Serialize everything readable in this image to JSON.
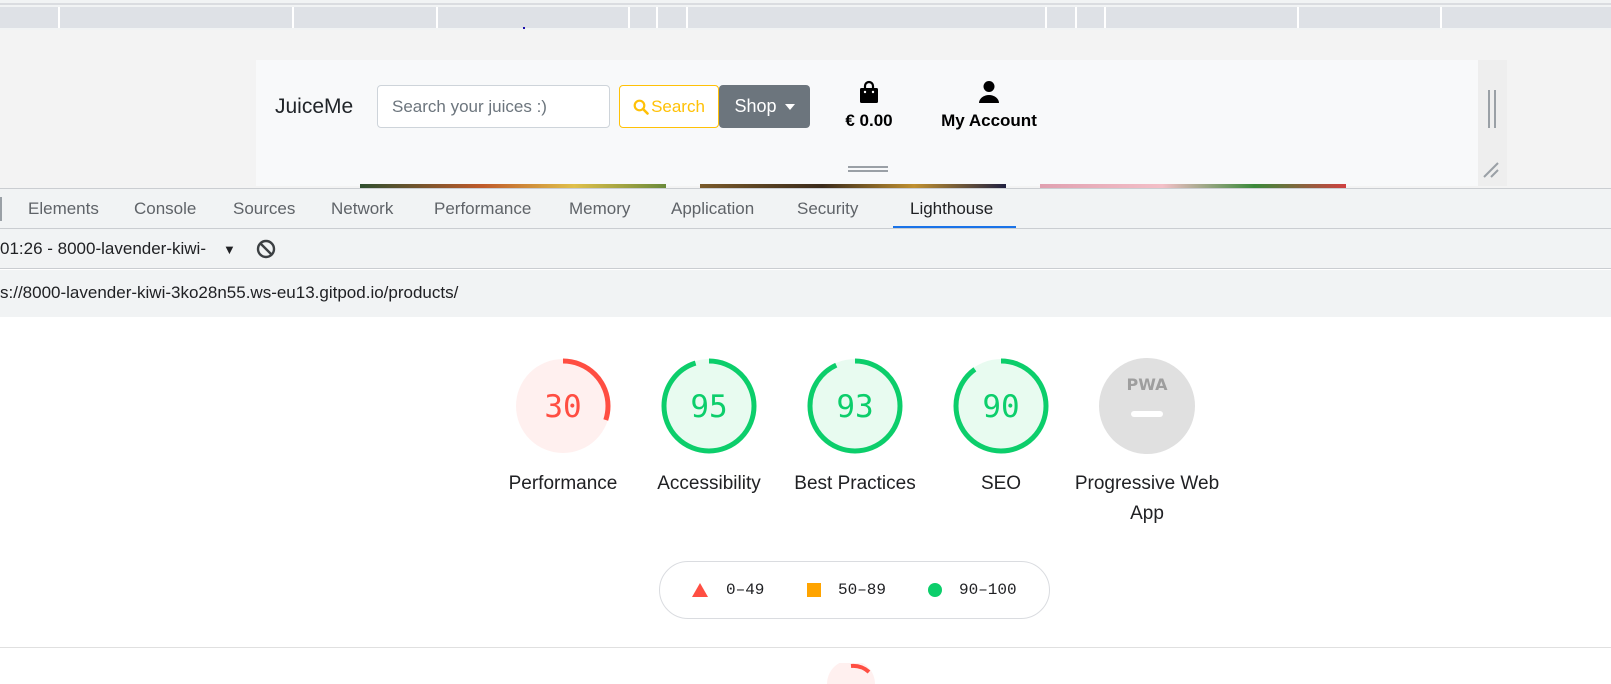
{
  "preview": {
    "brand": "JuiceMe",
    "search_placeholder": "Search your juices :)",
    "search_button": "Search",
    "shop_button": "Shop",
    "cart_total": "€ 0.00",
    "account_label": "My Account",
    "search_color": "#ffc107",
    "shop_color": "#6c757d"
  },
  "devtools": {
    "tabs": [
      "Elements",
      "Console",
      "Sources",
      "Network",
      "Performance",
      "Memory",
      "Application",
      "Security",
      "Lighthouse"
    ],
    "active_tab": "Lighthouse",
    "report_select": "01:26 - 8000-lavender-kiwi-",
    "url": "s://8000-lavender-kiwi-3ko28n55.ws-eu13.gitpod.io/products/"
  },
  "gauges": [
    {
      "score": "30",
      "label": "Performance",
      "fraction": 0.3,
      "color": "#ff4e42",
      "bg": "#fff0ef"
    },
    {
      "score": "95",
      "label": "Accessibility",
      "fraction": 0.95,
      "color": "#0cce6b",
      "bg": "#e8fbf0"
    },
    {
      "score": "93",
      "label": "Best Practices",
      "fraction": 0.93,
      "color": "#0cce6b",
      "bg": "#e8fbf0"
    },
    {
      "score": "90",
      "label": "SEO",
      "fraction": 0.9,
      "color": "#0cce6b",
      "bg": "#e8fbf0"
    },
    {
      "score": "PWA",
      "label": "Progressive Web App",
      "fraction": 0,
      "color": "#9e9e9e",
      "bg": "#e0e0e0"
    }
  ],
  "legend": [
    {
      "range": "0–49",
      "shape": "triangle",
      "color": "#ff4e42"
    },
    {
      "range": "50–89",
      "shape": "square",
      "color": "#ffa400"
    },
    {
      "range": "90–100",
      "shape": "circle",
      "color": "#0cce6b"
    }
  ]
}
